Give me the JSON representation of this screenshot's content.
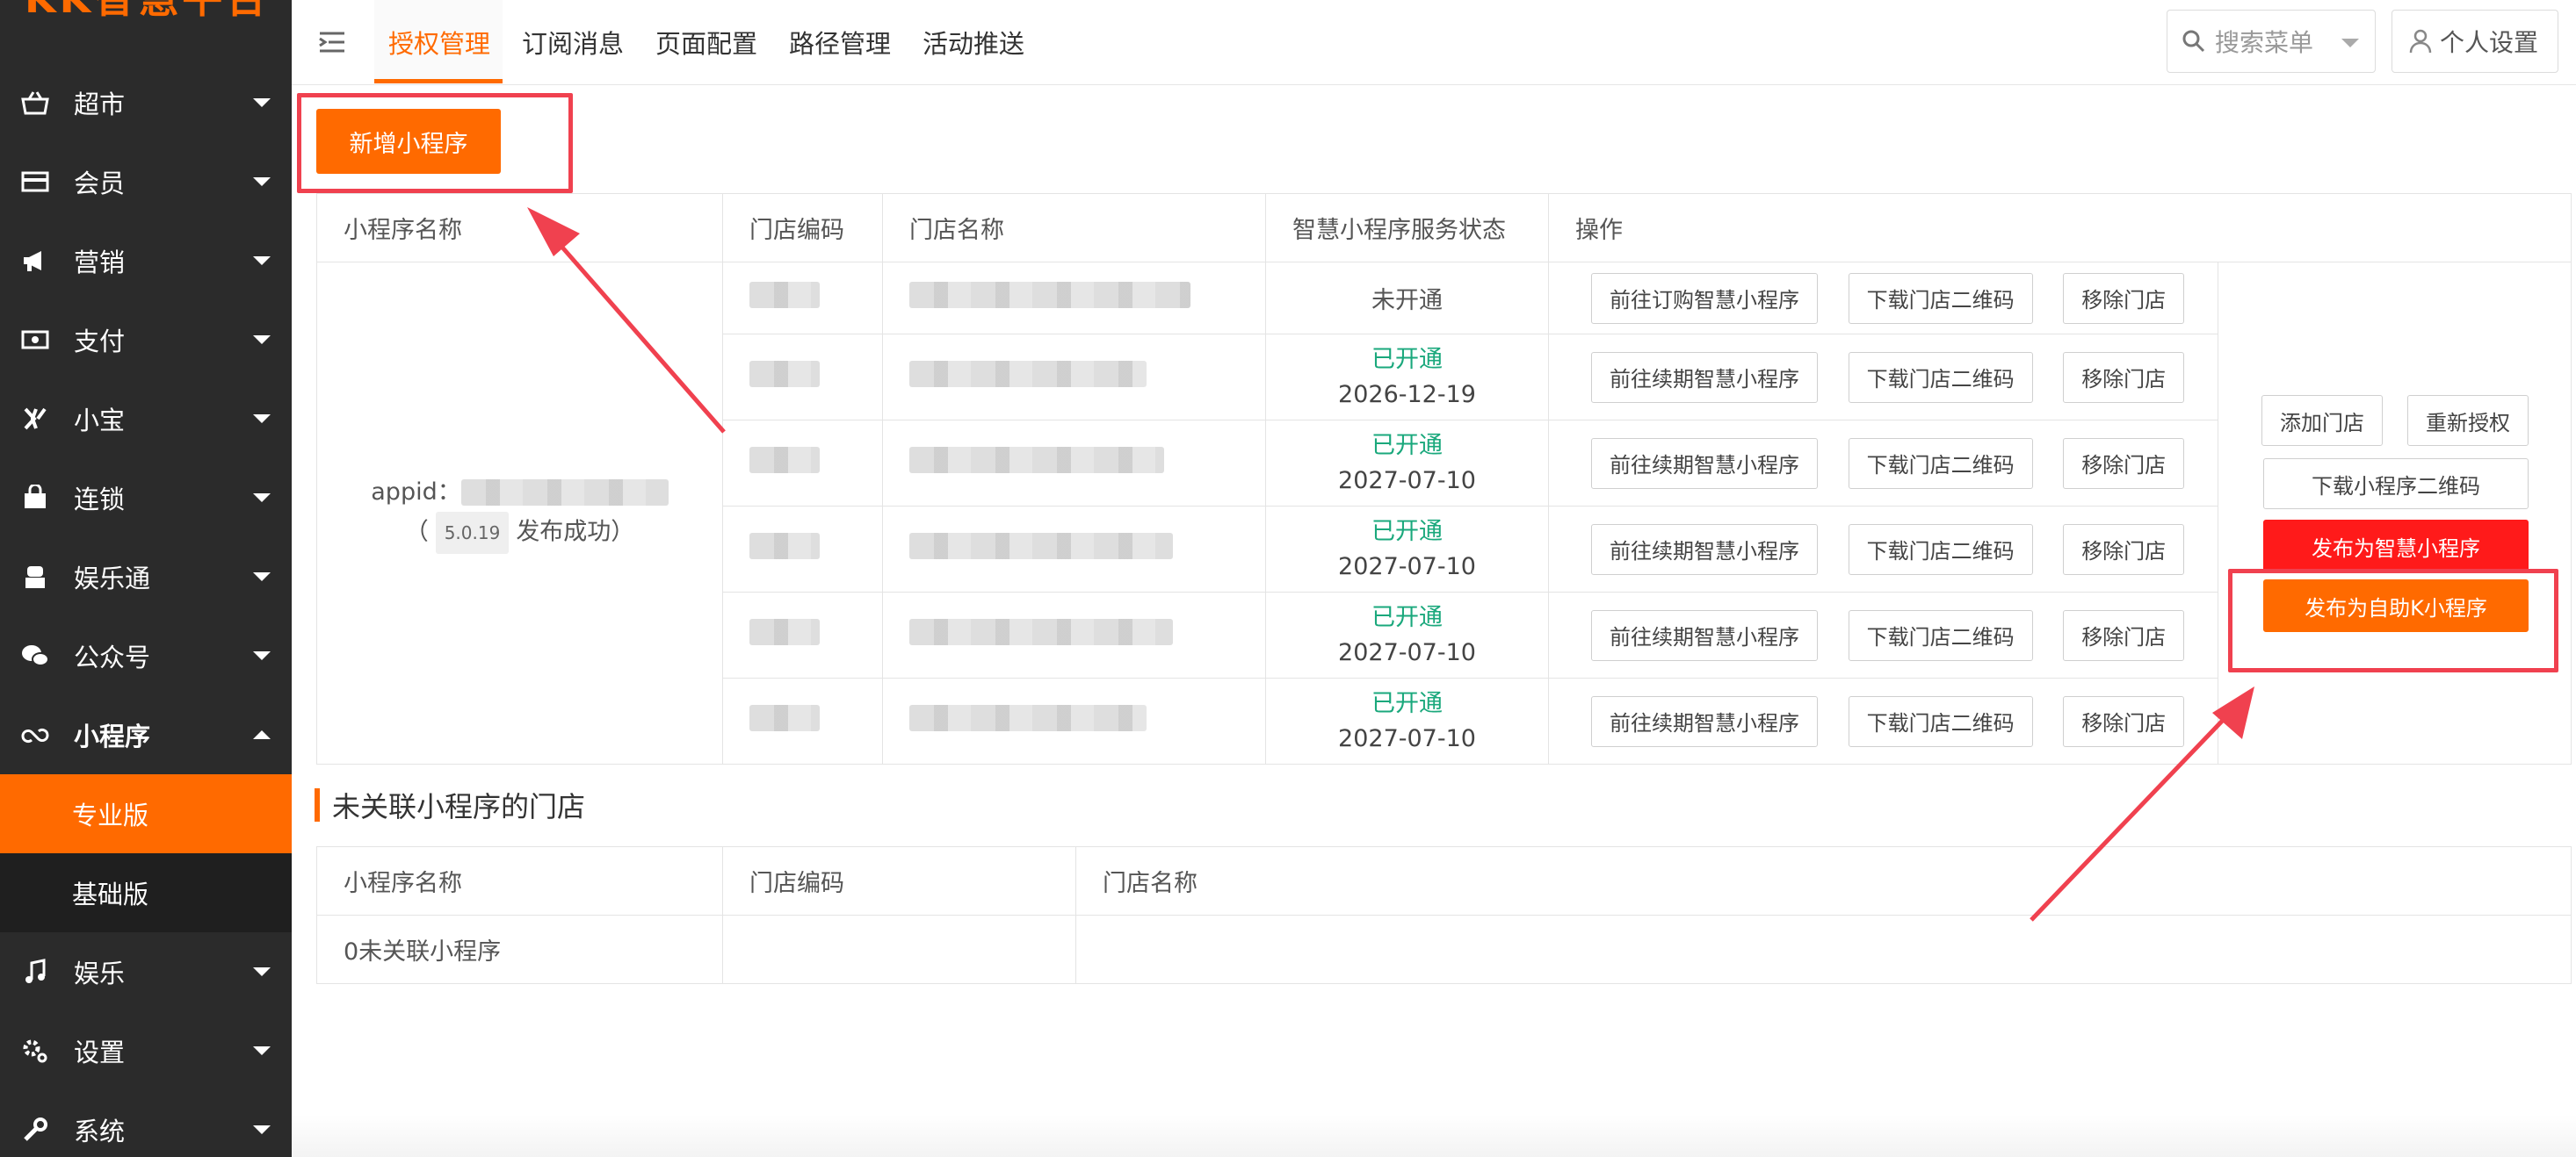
{
  "brand": {
    "logo_text": "KK智慧平台"
  },
  "sidebar": {
    "items": [
      {
        "label": "超市",
        "icon": "basket-icon"
      },
      {
        "label": "会员",
        "icon": "card-icon"
      },
      {
        "label": "营销",
        "icon": "megaphone-icon"
      },
      {
        "label": "支付",
        "icon": "cash-icon"
      },
      {
        "label": "小宝",
        "icon": "kb-icon"
      },
      {
        "label": "连锁",
        "icon": "shop-bag-icon"
      },
      {
        "label": "娱乐通",
        "icon": "bot-icon"
      },
      {
        "label": "公众号",
        "icon": "wechat-icon"
      },
      {
        "label": "小程序",
        "icon": "miniprogram-icon"
      },
      {
        "label": "娱乐",
        "icon": "music-icon"
      },
      {
        "label": "设置",
        "icon": "gear-icon"
      },
      {
        "label": "系统",
        "icon": "wrench-icon"
      }
    ],
    "sub_items": [
      {
        "label": "专业版"
      },
      {
        "label": "基础版"
      }
    ]
  },
  "topnav": {
    "tabs": [
      "授权管理",
      "订阅消息",
      "页面配置",
      "路径管理",
      "活动推送"
    ],
    "active_tab": "授权管理",
    "search_placeholder": "搜索菜单",
    "user_settings": "个人设置"
  },
  "main": {
    "add_button": "新增小程序",
    "table": {
      "headers": [
        "小程序名称",
        "门店编码",
        "门店名称",
        "智慧小程序服务状态",
        "操作"
      ],
      "appid_label": "appid：",
      "version_prefix": "（",
      "version": "5.0.19",
      "version_status": "发布成功）",
      "rows": [
        {
          "status": "未开通",
          "date": "",
          "action1": "前往订购智慧小程序"
        },
        {
          "status": "已开通",
          "date": "2026-12-19",
          "action1": "前往续期智慧小程序"
        },
        {
          "status": "已开通",
          "date": "2027-07-10",
          "action1": "前往续期智慧小程序"
        },
        {
          "status": "已开通",
          "date": "2027-07-10",
          "action1": "前往续期智慧小程序"
        },
        {
          "status": "已开通",
          "date": "2027-07-10",
          "action1": "前往续期智慧小程序"
        },
        {
          "status": "已开通",
          "date": "2027-07-10",
          "action1": "前往续期智慧小程序"
        }
      ],
      "action_download": "下载门店二维码",
      "action_remove": "移除门店",
      "side_actions": {
        "add_store": "添加门店",
        "reauthorize": "重新授权",
        "download_qr": "下载小程序二维码",
        "publish_smart": "发布为智慧小程序",
        "publish_kk": "发布为自助K小程序"
      }
    },
    "unlinked": {
      "title": "未关联小程序的门店",
      "headers": [
        "小程序名称",
        "门店编码",
        "门店名称"
      ],
      "empty_text": "0未关联小程序"
    }
  },
  "colors": {
    "accent": "#ff6a00",
    "sidebar_bg": "#2b2b2b",
    "status_ok": "#1aa87c",
    "publish_red": "#ff1a1a",
    "annotation": "#f0414f"
  }
}
